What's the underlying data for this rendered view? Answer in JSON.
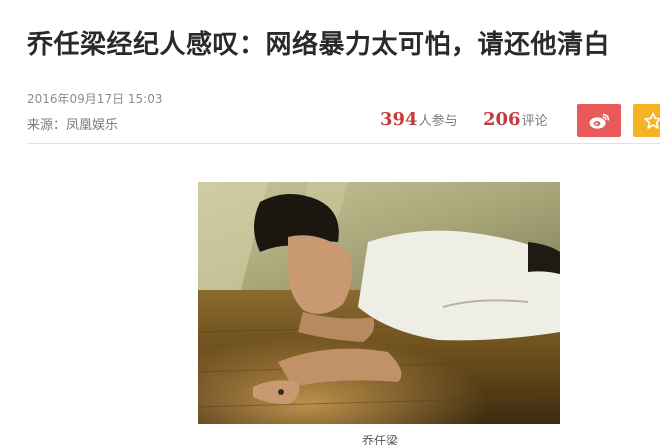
{
  "article": {
    "headline": "乔任梁经纪人感叹：网络暴力太可怕，请还他清白",
    "datetime": "2016年09月17日  15:03",
    "source": "来源：凤凰娱乐",
    "participants_count": "394",
    "participants_label": "人参与",
    "comments_count": "206",
    "comments_label": "评论",
    "caption": "乔任梁"
  },
  "share": {
    "weibo_icon": "weibo-icon",
    "fav_icon": "star-icon"
  },
  "colors": {
    "accent_red": "#c53b3b",
    "weibo_button": "#e85a5a",
    "fav_button": "#f5b324"
  }
}
